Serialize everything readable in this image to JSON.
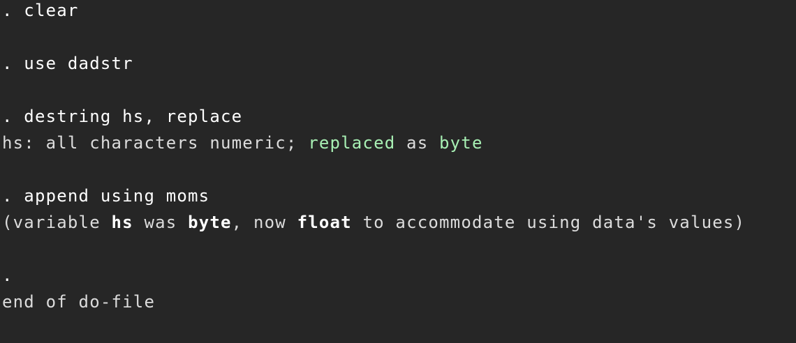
{
  "colors": {
    "background": "#262626",
    "text": "#e8e8e8",
    "highlight": "#a8f0b4"
  },
  "console": {
    "cmd_clear": ". clear",
    "cmd_use": ". use dadstr",
    "cmd_destring": ". destring hs, replace",
    "out_destring": {
      "prefix": "hs: all characters numeric; ",
      "replaced": "replaced",
      "as": " as ",
      "type": "byte"
    },
    "cmd_append": ". append using moms",
    "out_append": {
      "open": "(variable ",
      "var": "hs",
      "was": " was ",
      "old_type": "byte",
      "now": ", now ",
      "new_type": "float",
      "rest": " to accommodate using data's values)"
    },
    "prompt": ".",
    "end": "end of do-file"
  }
}
